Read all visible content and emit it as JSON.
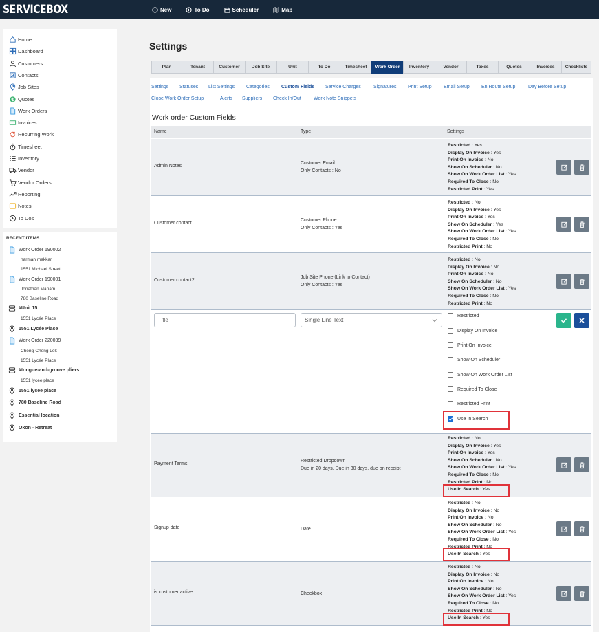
{
  "app": {
    "logo": "SERVICEBOX"
  },
  "topnav": [
    {
      "label": "New",
      "icon": "plus-circle-icon"
    },
    {
      "label": "To Do",
      "icon": "plus-circle-icon"
    },
    {
      "label": "Scheduler",
      "icon": "calendar-icon"
    },
    {
      "label": "Map",
      "icon": "map-icon"
    }
  ],
  "sidebar": {
    "items": [
      {
        "label": "Home",
        "icon": "home-icon"
      },
      {
        "label": "Dashboard",
        "icon": "dashboard-icon"
      },
      {
        "label": "Customers",
        "icon": "customers-icon"
      },
      {
        "label": "Contacts",
        "icon": "contacts-icon"
      },
      {
        "label": "Job Sites",
        "icon": "location-pin-icon"
      },
      {
        "label": "Quotes",
        "icon": "dollar-icon"
      },
      {
        "label": "Work Orders",
        "icon": "document-icon"
      },
      {
        "label": "Invoices",
        "icon": "invoice-icon"
      },
      {
        "label": "Recurring Work",
        "icon": "recurring-icon"
      },
      {
        "label": "Timesheet",
        "icon": "stopwatch-icon"
      },
      {
        "label": "Inventory",
        "icon": "list-icon"
      },
      {
        "label": "Vendor",
        "icon": "truck-icon"
      },
      {
        "label": "Vendor Orders",
        "icon": "cart-icon"
      },
      {
        "label": "Reporting",
        "icon": "trend-icon"
      },
      {
        "label": "Notes",
        "icon": "note-icon"
      },
      {
        "label": "To Dos",
        "icon": "clock-icon"
      }
    ]
  },
  "recent": {
    "title": "RECENT ITEMS",
    "items": [
      {
        "label": "Work Order 190002",
        "icon": "document-icon",
        "lines": [
          "harman makkar",
          "1551 Michael Street"
        ]
      },
      {
        "label": "Work Order 190001",
        "icon": "document-icon",
        "lines": [
          "Jonathan Mariam",
          "780 Baseline Road"
        ]
      },
      {
        "label": "#Unit 15",
        "icon": "unit-icon",
        "lines": [
          "1551 Lycée Place"
        ]
      },
      {
        "label": "1551 Lycée Place",
        "icon": "location-pin-icon",
        "lines": []
      },
      {
        "label": "Work Order 220039",
        "icon": "document-icon",
        "lines": [
          "Cheng-Cheng Lok",
          "1551 Lycée Place"
        ]
      },
      {
        "label": "#tongue-and-groove pliers",
        "icon": "unit-icon",
        "lines": [
          "1551 lycee place"
        ]
      },
      {
        "label": "1551 lycee place",
        "icon": "location-pin-icon",
        "lines": []
      },
      {
        "label": "780 Baseline Road",
        "icon": "location-pin-icon",
        "lines": []
      },
      {
        "label": "Essential location",
        "icon": "location-pin-icon",
        "lines": []
      },
      {
        "label": "Oxon - Retreat",
        "icon": "location-pin-icon",
        "lines": []
      }
    ]
  },
  "main": {
    "title": "Settings",
    "tabs": [
      "Plan",
      "Tenant",
      "Customer",
      "Job Site",
      "Unit",
      "To Do",
      "Timesheet",
      "Work Order",
      "Inventory",
      "Vendor",
      "Taxes",
      "Quotes",
      "Invoices",
      "Checklists"
    ],
    "active_tab": "Work Order",
    "subnav_row1": [
      "Settings",
      "Statuses",
      "List Settings",
      "Categories",
      "Custom Fields",
      "Service Charges",
      "Signatures",
      "Print Setup",
      "Email Setup",
      "En Route Setup",
      "Day Before Setup"
    ],
    "subnav_row2": [
      "Close Work Order Setup",
      "Alerts",
      "Suppliers",
      "Check In/Out",
      "Work Note Snippets"
    ],
    "active_subnav": "Custom Fields",
    "section_title": "Work order Custom Fields",
    "columns": [
      "Name",
      "Type",
      "Settings"
    ]
  },
  "rows": [
    {
      "name": "Admin Notes",
      "type": [
        "Customer Email",
        "Only Contacts : No"
      ],
      "settings": [
        [
          "Restricted",
          "Yes"
        ],
        [
          "Display On Invoice",
          "Yes"
        ],
        [
          "Print On Invoice",
          "No"
        ],
        [
          "Show On Scheduler",
          "No"
        ],
        [
          "Show On Work Order List",
          "Yes"
        ],
        [
          "Required To Close",
          "No"
        ],
        [
          "Restricted Print",
          "Yes"
        ]
      ]
    },
    {
      "name": "Customer contact",
      "type": [
        "Customer Phone",
        "Only Contacts : Yes"
      ],
      "settings": [
        [
          "Restricted",
          "No"
        ],
        [
          "Display On Invoice",
          "Yes"
        ],
        [
          "Print On Invoice",
          "Yes"
        ],
        [
          "Show On Scheduler",
          "Yes"
        ],
        [
          "Show On Work Order List",
          "Yes"
        ],
        [
          "Required To Close",
          "No"
        ],
        [
          "Restricted Print",
          "No"
        ]
      ]
    },
    {
      "name": "Customer contact2",
      "type": [
        "Job Site Phone (Link to Contact)",
        "Only Contacts : Yes"
      ],
      "settings": [
        [
          "Restricted",
          "No"
        ],
        [
          "Display On Invoice",
          "No"
        ],
        [
          "Print On Invoice",
          "No"
        ],
        [
          "Show On Scheduler",
          "No"
        ],
        [
          "Show On Work Order List",
          "Yes"
        ],
        [
          "Required To Close",
          "No"
        ],
        [
          "Restricted Print",
          "No"
        ]
      ]
    },
    {
      "name": "Payment Terms",
      "type": [
        "Restricted Dropdown",
        "Due in 20 days, Due in 30 days, due on receipt"
      ],
      "settings": [
        [
          "Restricted",
          "No"
        ],
        [
          "Display On Invoice",
          "Yes"
        ],
        [
          "Print On Invoice",
          "Yes"
        ],
        [
          "Show On Scheduler",
          "No"
        ],
        [
          "Show On Work Order List",
          "Yes"
        ],
        [
          "Required To Close",
          "No"
        ],
        [
          "Restricted Print",
          "No"
        ],
        [
          "Use In Search",
          "Yes"
        ]
      ]
    },
    {
      "name": "Signup date",
      "type": [
        "Date"
      ],
      "settings": [
        [
          "Restricted",
          "No"
        ],
        [
          "Display On Invoice",
          "No"
        ],
        [
          "Print On Invoice",
          "No"
        ],
        [
          "Show On Scheduler",
          "No"
        ],
        [
          "Show On Work Order List",
          "Yes"
        ],
        [
          "Required To Close",
          "No"
        ],
        [
          "Restricted Print",
          "No"
        ],
        [
          "Use In Search",
          "Yes"
        ]
      ]
    },
    {
      "name": "is customer active",
      "type": [
        "Checkbox"
      ],
      "settings": [
        [
          "Restricted",
          "No"
        ],
        [
          "Display On Invoice",
          "No"
        ],
        [
          "Print On Invoice",
          "No"
        ],
        [
          "Show On Scheduler",
          "No"
        ],
        [
          "Show On Work Order List",
          "Yes"
        ],
        [
          "Required To Close",
          "No"
        ],
        [
          "Restricted Print",
          "No"
        ],
        [
          "Use In Search",
          "Yes"
        ]
      ]
    }
  ],
  "edit_row": {
    "title_placeholder": "Title",
    "type_value": "Single Line Text",
    "checkboxes": [
      {
        "label": "Restricted",
        "checked": false
      },
      {
        "label": "Display On Invoice",
        "checked": false
      },
      {
        "label": "Print On Invoice",
        "checked": false
      },
      {
        "label": "Show On Scheduler",
        "checked": false
      },
      {
        "label": "Show On Work Order List",
        "checked": false
      },
      {
        "label": "Required To Close",
        "checked": false
      },
      {
        "label": "Restricted Print",
        "checked": false
      },
      {
        "label": "Use In Search",
        "checked": true
      }
    ]
  },
  "colors": {
    "topbar": "#17283a",
    "active_tab": "#0f3c78",
    "link": "#2d6db8",
    "save": "#2bb58c",
    "cancel": "#1b4f9a",
    "highlight": "#e0333a"
  }
}
